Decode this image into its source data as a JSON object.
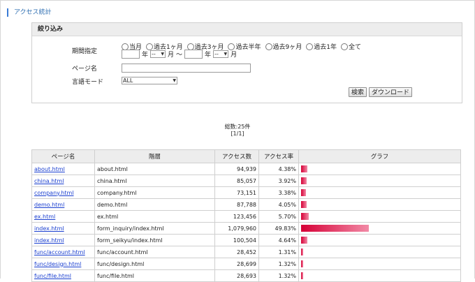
{
  "title": "アクセス統計",
  "filter": {
    "heading": "絞り込み",
    "period_label": "期間指定",
    "period_options": [
      "当月",
      "過去1ヶ月",
      "過去3ヶ月",
      "過去半年",
      "過去9ヶ月",
      "過去1年",
      "全て"
    ],
    "year_unit": "年",
    "month_unit": "月",
    "range_sep": "～",
    "month_placeholder": "--",
    "page_label": "ページ名",
    "page_value": "",
    "lang_label": "言語モード",
    "lang_value": "ALL",
    "search_button": "検索",
    "download_button": "ダウンロード"
  },
  "summary": {
    "total": "総数:25件",
    "pager": "[1/1]"
  },
  "table": {
    "headers": [
      "ページ名",
      "階層",
      "アクセス数",
      "アクセス率",
      "グラフ"
    ],
    "rows": [
      {
        "page": "about.html",
        "path": "about.html",
        "count": "94,939",
        "rate": "4.38%",
        "pct": 4.38
      },
      {
        "page": "china.html",
        "path": "china.html",
        "count": "85,057",
        "rate": "3.92%",
        "pct": 3.92
      },
      {
        "page": "company.html",
        "path": "company.html",
        "count": "73,151",
        "rate": "3.38%",
        "pct": 3.38
      },
      {
        "page": "demo.html",
        "path": "demo.html",
        "count": "87,788",
        "rate": "4.05%",
        "pct": 4.05
      },
      {
        "page": "ex.html",
        "path": "ex.html",
        "count": "123,456",
        "rate": "5.70%",
        "pct": 5.7
      },
      {
        "page": "index.html",
        "path": "form_inquiry/index.html",
        "count": "1,079,960",
        "rate": "49.83%",
        "pct": 49.83
      },
      {
        "page": "index.html",
        "path": "form_seikyu/index.html",
        "count": "100,504",
        "rate": "4.64%",
        "pct": 4.64
      },
      {
        "page": "func/account.html",
        "path": "func/account.html",
        "count": "28,452",
        "rate": "1.31%",
        "pct": 1.31
      },
      {
        "page": "func/design.html",
        "path": "func/design.html",
        "count": "28,699",
        "rate": "1.32%",
        "pct": 1.32
      },
      {
        "page": "func/file.html",
        "path": "func/file.html",
        "count": "28,693",
        "rate": "1.32%",
        "pct": 1.32
      }
    ]
  },
  "colors": {
    "accent": "#3a7bd5",
    "bar": "#d60036",
    "link": "#1a3fd0"
  }
}
